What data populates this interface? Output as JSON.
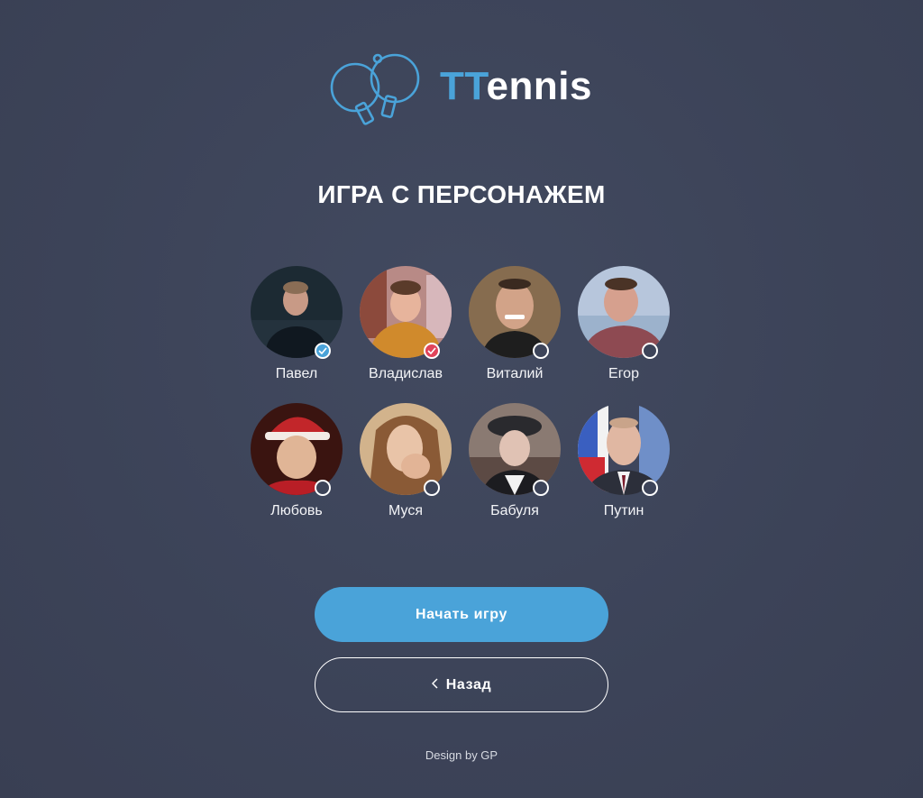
{
  "logo": {
    "prefix": "TT",
    "suffix": "ennis",
    "accent": "#4aa3d9"
  },
  "heading": "ИГРА С ПЕРСОНАЖЕМ",
  "characters": [
    {
      "name": "Павел",
      "selection": "blue"
    },
    {
      "name": "Владислав",
      "selection": "red"
    },
    {
      "name": "Виталий",
      "selection": "none"
    },
    {
      "name": "Егор",
      "selection": "none"
    },
    {
      "name": "Любовь",
      "selection": "none"
    },
    {
      "name": "Муся",
      "selection": "none"
    },
    {
      "name": "Бабуля",
      "selection": "none"
    },
    {
      "name": "Путин",
      "selection": "none"
    }
  ],
  "buttons": {
    "start": "Начать игру",
    "back": "Назад"
  },
  "footer": "Design by GP",
  "colors": {
    "background": "#3d4459",
    "primary": "#4aa3d9",
    "selected_red": "#e0445a"
  }
}
